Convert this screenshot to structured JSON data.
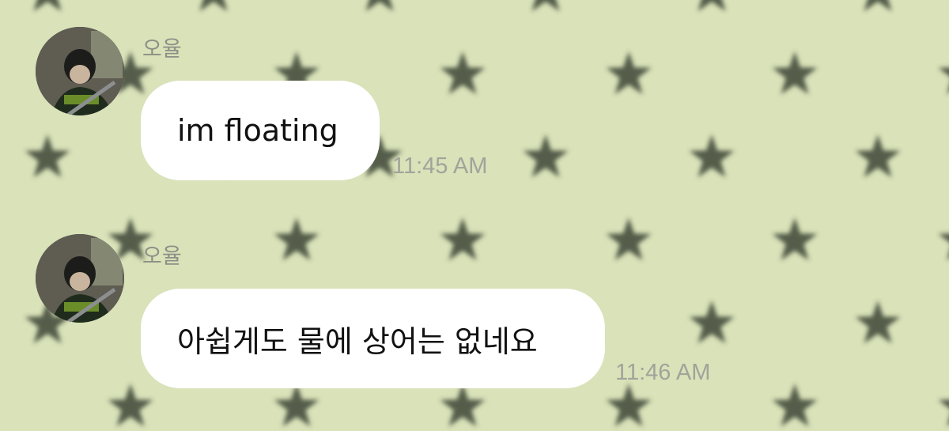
{
  "wallpaper": {
    "background_color": "#d9e2b9",
    "star_color": "#3d4636",
    "pattern_icon": "star-icon"
  },
  "messages": [
    {
      "sender": "오율",
      "text": "im floating",
      "time": "11:45 AM",
      "avatar_icon": "profile-photo"
    },
    {
      "sender": "오율",
      "text": "아쉽게도 물에 상어는 없네요",
      "time": "11:46 AM",
      "avatar_icon": "profile-photo"
    }
  ]
}
